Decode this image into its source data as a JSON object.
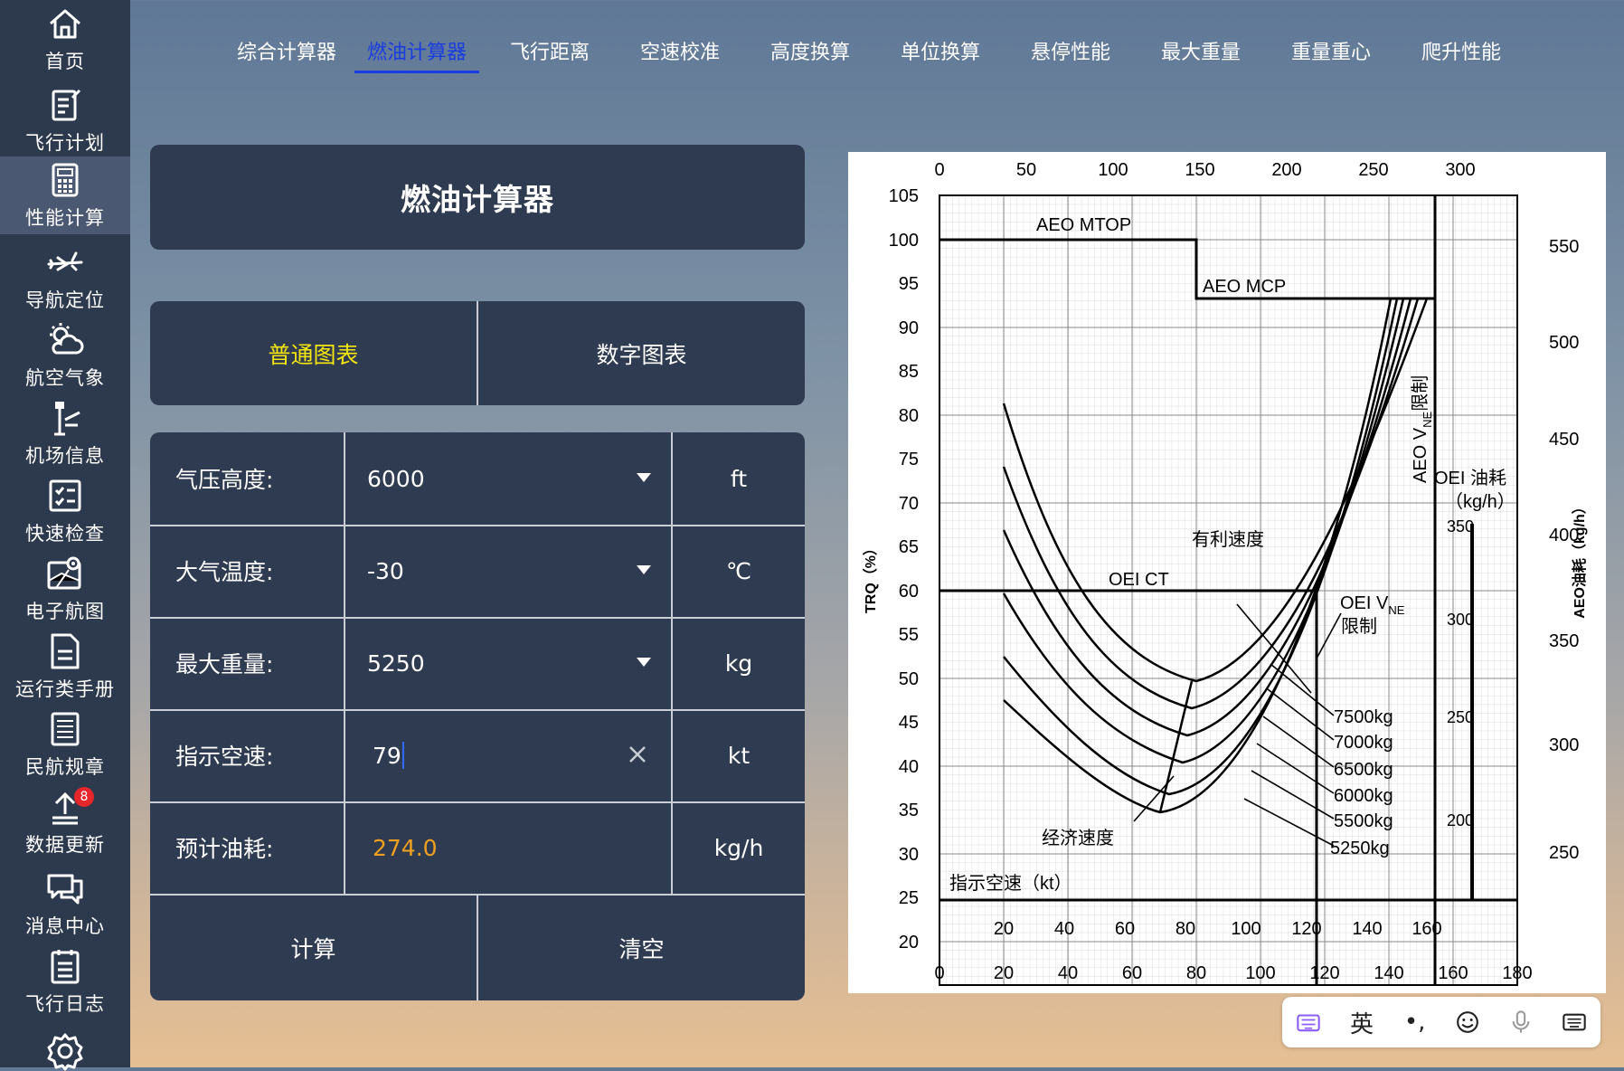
{
  "sidebar": {
    "items": [
      {
        "label": "首页",
        "icon": "home-icon"
      },
      {
        "label": "飞行计划",
        "icon": "flight-plan-icon"
      },
      {
        "label": "性能计算",
        "icon": "calculator-icon",
        "active": true
      },
      {
        "label": "导航定位",
        "icon": "airplane-icon"
      },
      {
        "label": "航空气象",
        "icon": "weather-icon"
      },
      {
        "label": "机场信息",
        "icon": "airport-icon"
      },
      {
        "label": "快速检查",
        "icon": "checklist-icon"
      },
      {
        "label": "电子航图",
        "icon": "map-icon"
      },
      {
        "label": "运行类手册",
        "icon": "manual-icon"
      },
      {
        "label": "民航规章",
        "icon": "regulation-icon"
      },
      {
        "label": "数据更新",
        "icon": "update-icon",
        "badge": "8"
      },
      {
        "label": "消息中心",
        "icon": "message-icon"
      },
      {
        "label": "飞行日志",
        "icon": "logbook-icon"
      }
    ]
  },
  "tabs": [
    "综合计算器",
    "燃油计算器",
    "飞行距离",
    "空速校准",
    "高度换算",
    "单位换算",
    "悬停性能",
    "最大重量",
    "重量重心",
    "爬升性能"
  ],
  "active_tab": "燃油计算器",
  "panel_title": "燃油计算器",
  "chart_toggle": {
    "left": "普通图表",
    "right": "数字图表"
  },
  "form": {
    "pressure_altitude": {
      "label": "气压高度:",
      "value": "6000",
      "unit": "ft"
    },
    "temperature": {
      "label": "大气温度:",
      "value": "-30",
      "unit": "℃"
    },
    "max_weight": {
      "label": "最大重量:",
      "value": "5250",
      "unit": "kg"
    },
    "indicated_airspeed": {
      "label": "指示空速:",
      "value": "79",
      "unit": "kt"
    },
    "fuel_flow": {
      "label": "预计油耗:",
      "value": "274.0",
      "unit": "kg/h"
    }
  },
  "buttons": {
    "calculate": "计算",
    "clear": "清空"
  },
  "chart": {
    "top_ticks": [
      "0",
      "50",
      "100",
      "150",
      "200",
      "250",
      "300"
    ],
    "left_ticks": [
      "105",
      "100",
      "95",
      "90",
      "85",
      "80",
      "75",
      "70",
      "65",
      "60",
      "55",
      "50",
      "45",
      "40",
      "35",
      "30",
      "25",
      "20"
    ],
    "bottom_ticks": [
      "0",
      "20",
      "40",
      "60",
      "80",
      "100",
      "120",
      "140",
      "160",
      "180"
    ],
    "inner_ticks": [
      "20",
      "40",
      "60",
      "80",
      "100",
      "120",
      "140",
      "160"
    ],
    "right_ticks": [
      "550",
      "500",
      "450",
      "400",
      "350",
      "300",
      "250"
    ],
    "oei_ticks": [
      "350",
      "300",
      "250",
      "200"
    ],
    "y_label": "TRQ（%）",
    "right_label": "AEO油耗（kg/h）",
    "aeo_mtop": "AEO MTOP",
    "aeo_mcp": "AEO MCP",
    "oei_ct": "OEI CT",
    "aeo_vne_main": "AEO V",
    "aeo_vne_sub": "NE",
    "aeo_vne_suffix": "限制",
    "oei_fuel_line1": "OEI 油耗",
    "oei_fuel_line2": "（kg/h）",
    "best_speed": "有利速度",
    "oei_vne_main": "OEI V",
    "oei_vne_sub": "NE",
    "oei_vne_line2": "限制",
    "eco_speed": "经济速度",
    "ias_label": "指示空速（kt）",
    "weights": [
      "7500kg",
      "7000kg",
      "6500kg",
      "6000kg",
      "5500kg",
      "5250kg"
    ]
  },
  "ime": {
    "lang": "英",
    "punct": "•,"
  }
}
